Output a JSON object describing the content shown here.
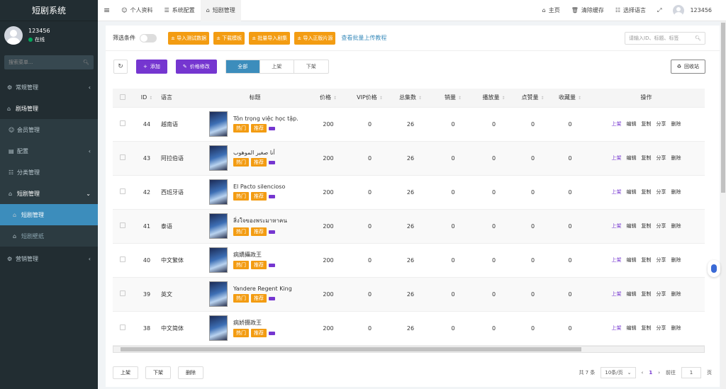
{
  "app": {
    "title": "短剧系统"
  },
  "sidebar": {
    "user": {
      "name": "123456",
      "status": "在线"
    },
    "search_placeholder": "搜索菜单...",
    "items": [
      {
        "label": "常规管理"
      },
      {
        "label": "剧场管理"
      },
      {
        "label": "会员管理"
      },
      {
        "label": "配置"
      },
      {
        "label": "分类管理"
      },
      {
        "label": "短剧管理"
      },
      {
        "label": "短剧管理"
      },
      {
        "label": "短剧壁纸"
      },
      {
        "label": "营销管理"
      }
    ]
  },
  "topbar": {
    "tabs": [
      {
        "label": "个人资料"
      },
      {
        "label": "系统配置"
      },
      {
        "label": "短剧管理"
      }
    ],
    "right": {
      "home": "主页",
      "clear_cache": "清除缓存",
      "language": "选择语言",
      "user": "123456"
    }
  },
  "filter": {
    "label": "筛选条件",
    "buttons": [
      "± 导入测试数据",
      "± 下载模板",
      "± 批量导入剧集",
      "± 导入正版片源"
    ],
    "link": "查看批量上传教程",
    "search_placeholder": "请输入ID、标题、标签"
  },
  "toolbar": {
    "add": "添加",
    "price_edit": "价格修改",
    "segments": [
      "全部",
      "上架",
      "下架"
    ],
    "recycle": "回收站"
  },
  "table": {
    "columns": [
      "ID",
      "语言",
      "标题",
      "价格",
      "VIP价格",
      "总集数",
      "销量",
      "播放量",
      "点赞量",
      "收藏量",
      "操作"
    ],
    "tags": [
      "热门",
      "推荐"
    ],
    "ops": [
      "上架",
      "编辑",
      "复制",
      "分享",
      "删除"
    ],
    "rows": [
      {
        "id": "44",
        "lang": "越南语",
        "title": "Tôn trọng việc học tập.",
        "price": "200",
        "vip": "0",
        "episodes": "26",
        "sales": "0",
        "plays": "0",
        "likes": "0",
        "favs": "0"
      },
      {
        "id": "43",
        "lang": "阿拉伯语",
        "title": "أنا صغير الموهوب",
        "price": "200",
        "vip": "0",
        "episodes": "26",
        "sales": "0",
        "plays": "0",
        "likes": "0",
        "favs": "0"
      },
      {
        "id": "42",
        "lang": "西班牙语",
        "title": "El Pacto silencioso",
        "price": "200",
        "vip": "0",
        "episodes": "26",
        "sales": "0",
        "plays": "0",
        "likes": "0",
        "favs": "0"
      },
      {
        "id": "41",
        "lang": "泰语",
        "title": "สิ่งใจของพระมาหาคน",
        "price": "200",
        "vip": "0",
        "episodes": "26",
        "sales": "0",
        "plays": "0",
        "likes": "0",
        "favs": "0"
      },
      {
        "id": "40",
        "lang": "中文繁体",
        "title": "病嬌攝政王",
        "price": "200",
        "vip": "0",
        "episodes": "26",
        "sales": "0",
        "plays": "0",
        "likes": "0",
        "favs": "0"
      },
      {
        "id": "39",
        "lang": "英文",
        "title": "Yandere Regent King",
        "price": "200",
        "vip": "0",
        "episodes": "26",
        "sales": "0",
        "plays": "0",
        "likes": "0",
        "favs": "0"
      },
      {
        "id": "38",
        "lang": "中文简体",
        "title": "病娇摄政王",
        "price": "200",
        "vip": "0",
        "episodes": "26",
        "sales": "0",
        "plays": "0",
        "likes": "0",
        "favs": "0"
      }
    ]
  },
  "bottom": {
    "buttons": [
      "上架",
      "下架",
      "删除"
    ],
    "total": "共 7 条",
    "page_size": "10条/页",
    "current_page": "1",
    "goto_label": "前往",
    "goto_value": "1",
    "page_suffix": "页"
  },
  "colors": {
    "sidebar_bg": "#222d32",
    "active_blue": "#3c8dbc",
    "orange": "#f39c12",
    "purple": "#7536d0"
  }
}
